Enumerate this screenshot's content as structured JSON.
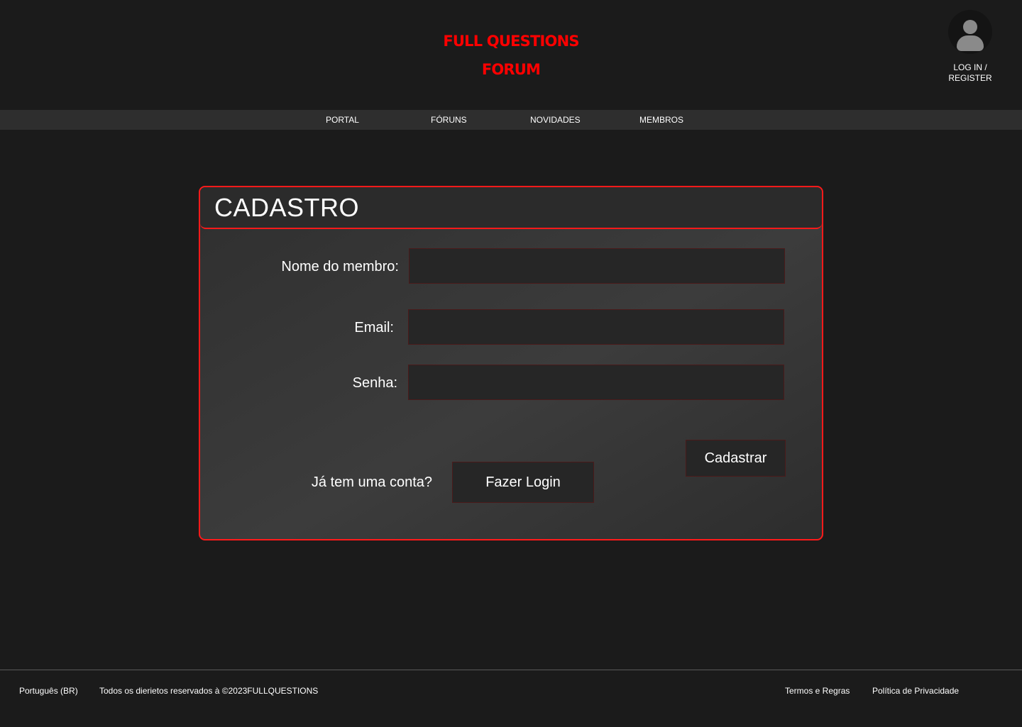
{
  "header": {
    "logo_line1": "FULL QUESTIONS",
    "logo_line2": "FORUM",
    "user_icon": "user-avatar-icon",
    "login_line1": "LOG IN /",
    "login_line2": "REGISTER"
  },
  "nav": {
    "items": [
      {
        "label": "PORTAL"
      },
      {
        "label": "FÓRUNS"
      },
      {
        "label": "NOVIDADES"
      },
      {
        "label": "MEMBROS"
      }
    ]
  },
  "form": {
    "title": "CADASTRO",
    "member_label": "Nome do membro:",
    "member_value": "",
    "email_label": "Email:",
    "email_value": "",
    "password_label": "Senha:",
    "password_value": "",
    "submit_label": "Cadastrar",
    "has_account_text": "Já tem uma conta?",
    "login_button_label": "Fazer Login"
  },
  "footer": {
    "language": "Português (BR)",
    "copyright": "Todos os dierietos reservados à ©2023FULLQUESTIONS",
    "terms": "Termos e Regras",
    "privacy": "Política de Privacidade"
  },
  "colors": {
    "accent": "#ff0000",
    "background": "#1b1b1b",
    "nav_background": "#2e2e2e",
    "card_border": "#ff1a1a"
  }
}
